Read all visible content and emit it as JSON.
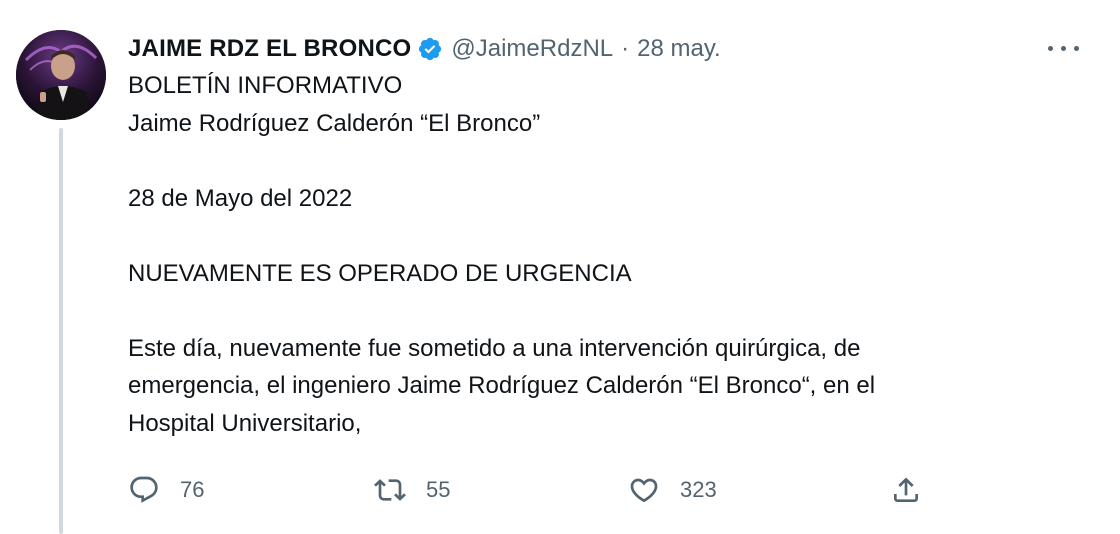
{
  "tweet": {
    "author_name": "JAIME RDZ EL BRONCO",
    "handle": "@JaimeRdzNL",
    "separator": "·",
    "date": "28 may.",
    "lines": [
      "BOLETÍN INFORMATIVO",
      "Jaime Rodríguez Calderón “El Bronco”",
      "",
      "28 de Mayo del 2022",
      "",
      "NUEVAMENTE ES OPERADO DE URGENCIA",
      "",
      "Este día, nuevamente fue sometido a una intervención quirúrgica, de",
      "emergencia, el ingeniero Jaime Rodríguez Calderón “El Bronco“, en el",
      "Hospital Universitario,"
    ]
  },
  "actions": {
    "reply_count": "76",
    "retweet_count": "55",
    "like_count": "323"
  },
  "icons": {
    "verified": "verified-badge-icon",
    "more": "more-options-icon",
    "reply": "reply-icon",
    "retweet": "retweet-icon",
    "like": "heart-icon",
    "share": "share-icon"
  },
  "colors": {
    "verified_blue": "#1d9bf0",
    "text": "#0f1419",
    "secondary": "#536471",
    "thread_line": "#cfd9de"
  }
}
